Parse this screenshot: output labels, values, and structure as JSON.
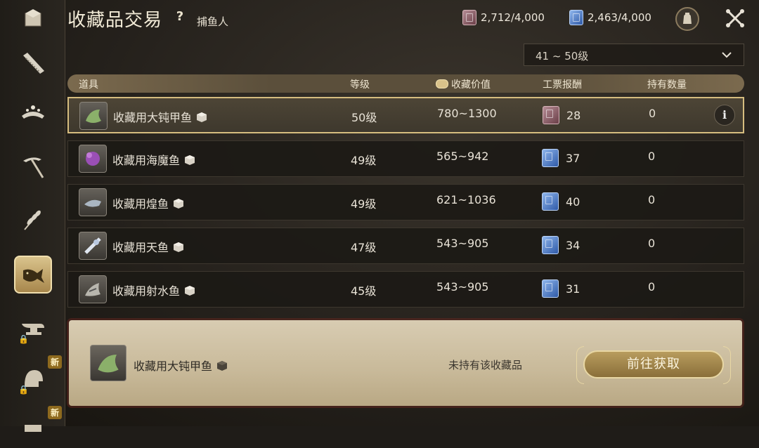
{
  "header": {
    "title": "收藏品交易",
    "help_label": "?",
    "subtitle": "捕鱼人"
  },
  "currencies": [
    {
      "icon": "red-ticket-icon",
      "amount": "2,712/4,000"
    },
    {
      "icon": "blue-ticket-icon",
      "amount": "2,463/4,000"
    }
  ],
  "filter": {
    "selected": "41 ~ 50级"
  },
  "columns": {
    "item": "道具",
    "level": "等级",
    "value": "收藏价值",
    "reward": "工票报酬",
    "owned": "持有数量"
  },
  "rows": [
    {
      "name": "收藏用大钝甲鱼",
      "level": "50级",
      "value": "780~1300",
      "reward_type": "red",
      "reward": "28",
      "owned": "0",
      "selected": true
    },
    {
      "name": "收藏用海魔鱼",
      "level": "49级",
      "value": "565~942",
      "reward_type": "blue",
      "reward": "37",
      "owned": "0"
    },
    {
      "name": "收藏用煌鱼",
      "level": "49级",
      "value": "621~1036",
      "reward_type": "blue",
      "reward": "40",
      "owned": "0"
    },
    {
      "name": "收藏用天鱼",
      "level": "47级",
      "value": "543~905",
      "reward_type": "blue",
      "reward": "34",
      "owned": "0"
    },
    {
      "name": "收藏用射水鱼",
      "level": "45级",
      "value": "543~905",
      "reward_type": "blue",
      "reward": "31",
      "owned": "0"
    }
  ],
  "info_label": "i",
  "detail": {
    "name": "收藏用大钝甲鱼",
    "status": "未持有该收藏品",
    "button": "前往获取"
  },
  "sidebar": {
    "new_badge": "新",
    "items": [
      {
        "icon": "crate-icon"
      },
      {
        "icon": "saw-icon"
      },
      {
        "icon": "tiara-icon"
      },
      {
        "icon": "pickaxe-icon"
      },
      {
        "icon": "wheat-icon"
      },
      {
        "icon": "fish-icon",
        "active": true
      },
      {
        "icon": "anvil-icon",
        "locked": true
      },
      {
        "icon": "helmet-icon",
        "locked": true,
        "new": true
      },
      {
        "icon": "cook-icon",
        "new": true
      }
    ]
  },
  "colors": {
    "accent_gold": "#d6bd7f",
    "panel_bg": "#d8ccb2",
    "button_gold": "#b89c5e",
    "red_ticket": "#8a5560",
    "blue_ticket": "#3f6fc0"
  }
}
